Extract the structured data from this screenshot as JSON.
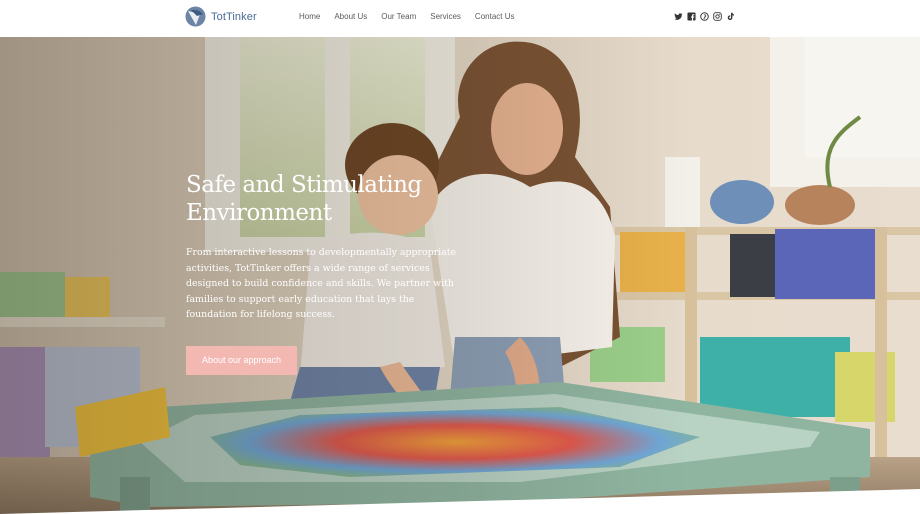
{
  "brand": {
    "name": "TotTinker",
    "accent": "#4a6c9a"
  },
  "nav": {
    "items": [
      {
        "label": "Home"
      },
      {
        "label": "About Us"
      },
      {
        "label": "Our Team"
      },
      {
        "label": "Services"
      },
      {
        "label": "Contact Us"
      }
    ]
  },
  "social": {
    "icons": [
      "twitter-icon",
      "facebook-icon",
      "pinterest-icon",
      "instagram-icon",
      "tiktok-icon"
    ]
  },
  "hero": {
    "title": "Safe and Stimulating Environment",
    "body": "From interactive lessons to developmentally appropriate activities, TotTinker offers a wide range of services designed to build confidence and skills. We partner with families to support early education that lays the foundation for lifelong success.",
    "cta_label": "About our approach",
    "cta_color": "#f4b8b3"
  }
}
